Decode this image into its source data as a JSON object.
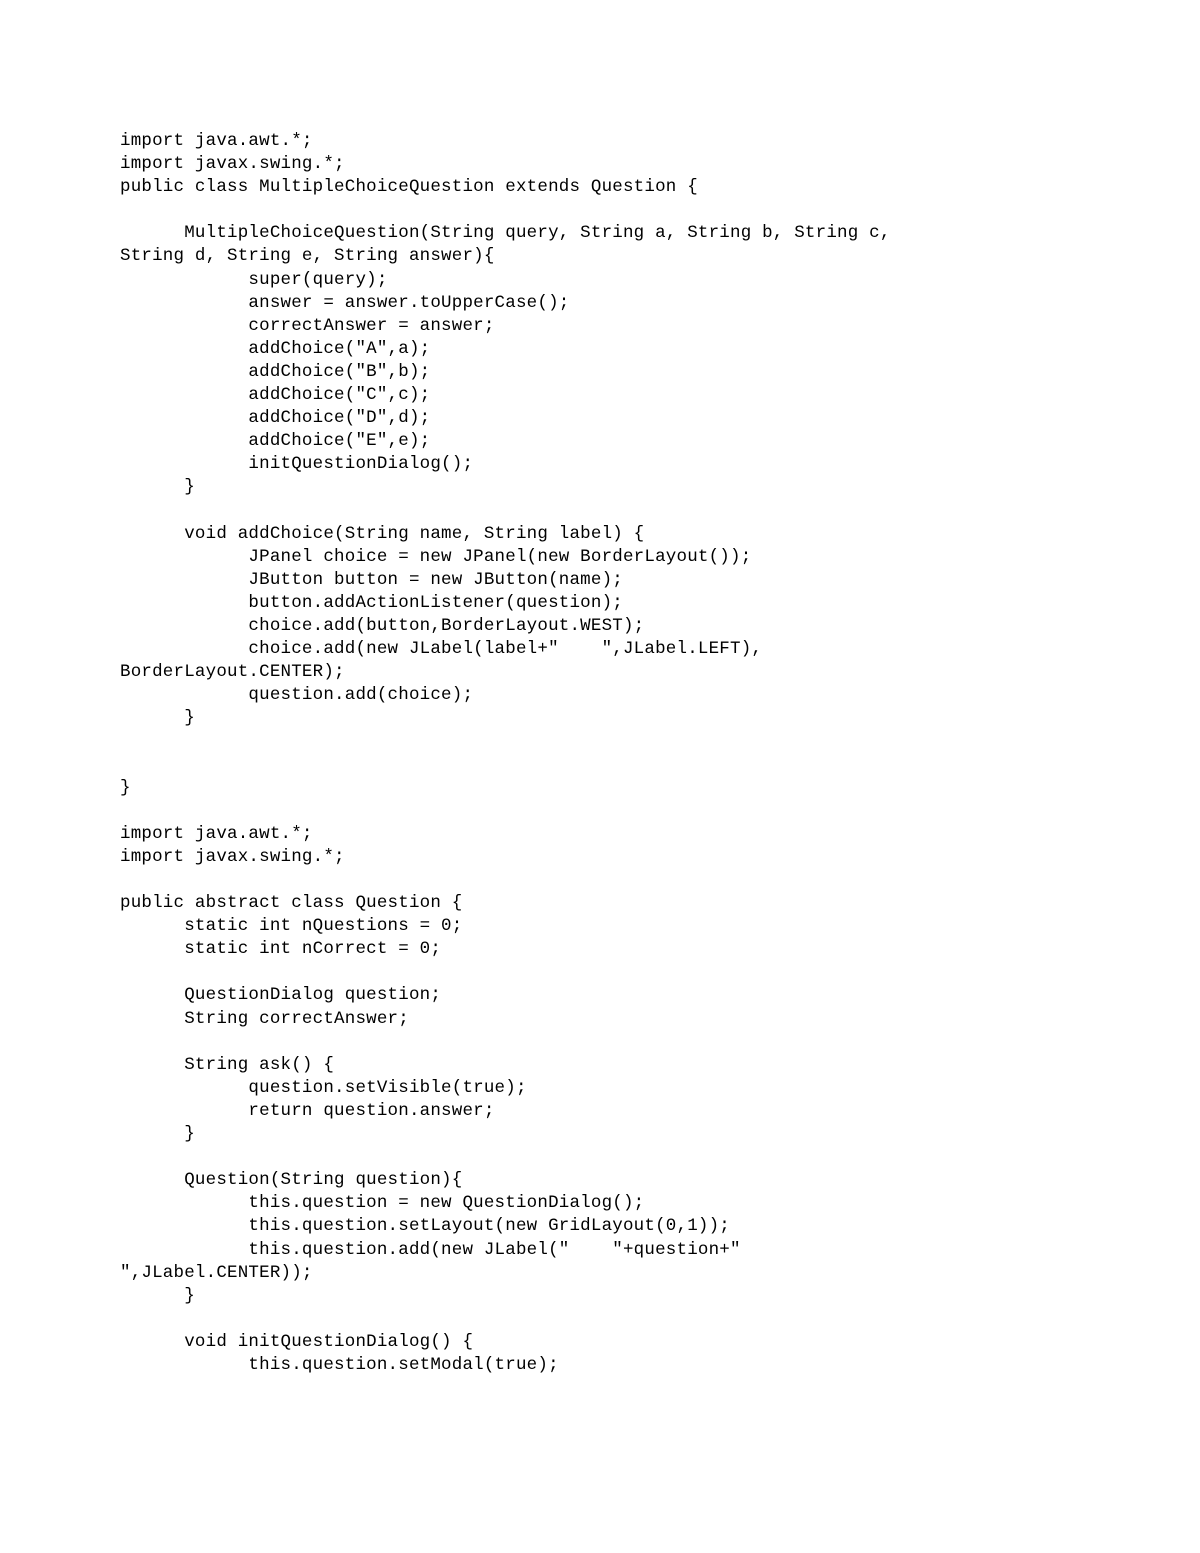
{
  "code_lines": [
    "import java.awt.*;",
    "import javax.swing.*;",
    "public class MultipleChoiceQuestion extends Question {",
    "",
    "      MultipleChoiceQuestion(String query, String a, String b, String c,",
    "String d, String e, String answer){",
    "            super(query);",
    "            answer = answer.toUpperCase();",
    "            correctAnswer = answer;",
    "            addChoice(\"A\",a);",
    "            addChoice(\"B\",b);",
    "            addChoice(\"C\",c);",
    "            addChoice(\"D\",d);",
    "            addChoice(\"E\",e);",
    "            initQuestionDialog();",
    "      }",
    "",
    "      void addChoice(String name, String label) {",
    "            JPanel choice = new JPanel(new BorderLayout());",
    "            JButton button = new JButton(name);",
    "            button.addActionListener(question);",
    "            choice.add(button,BorderLayout.WEST);",
    "            choice.add(new JLabel(label+\"    \",JLabel.LEFT),",
    "BorderLayout.CENTER);",
    "            question.add(choice);",
    "      }",
    "",
    "",
    "}",
    "",
    "import java.awt.*;",
    "import javax.swing.*;",
    "",
    "public abstract class Question {",
    "      static int nQuestions = 0;",
    "      static int nCorrect = 0;",
    "",
    "      QuestionDialog question;",
    "      String correctAnswer;",
    "",
    "      String ask() {",
    "            question.setVisible(true);",
    "            return question.answer;",
    "      }",
    "",
    "      Question(String question){",
    "            this.question = new QuestionDialog();",
    "            this.question.setLayout(new GridLayout(0,1));",
    "            this.question.add(new JLabel(\"    \"+question+\"",
    "\",JLabel.CENTER));",
    "      }",
    "",
    "      void initQuestionDialog() {",
    "            this.question.setModal(true);"
  ]
}
